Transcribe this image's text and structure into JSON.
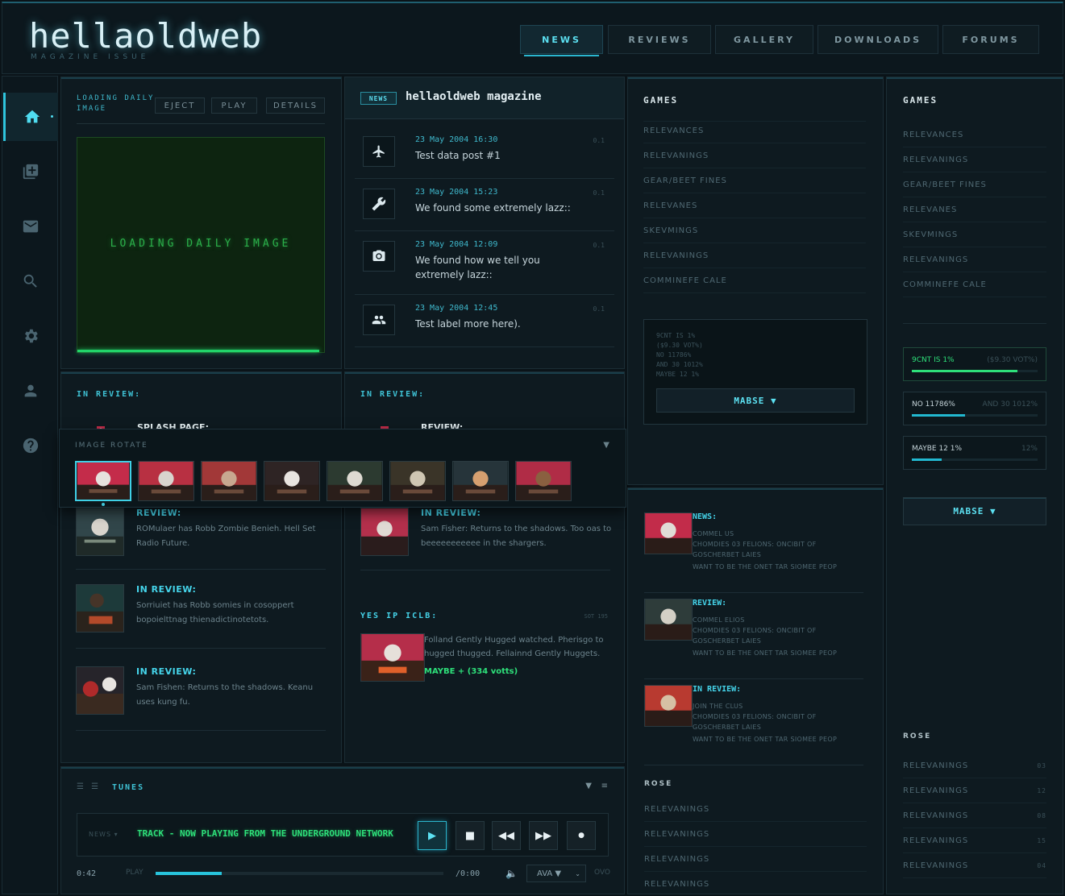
{
  "header": {
    "logo": "hellaoldweb",
    "subtitle": "MAGAZINE ISSUE",
    "nav": [
      {
        "label": "NEWS",
        "active": true
      },
      {
        "label": "REVIEWS"
      },
      {
        "label": "GALLERY"
      },
      {
        "label": "DOWNLOADS"
      },
      {
        "label": "FORUMS"
      }
    ]
  },
  "sidebar": {
    "icons": [
      "home-icon",
      "add-collection-icon",
      "mail-icon",
      "search-icon",
      "gear-icon",
      "user-icon",
      "help-icon"
    ]
  },
  "daily_image": {
    "label": "LOADING DAILY IMAGE",
    "eject": "EJECT",
    "play": "PLAY",
    "details": "DETAILS",
    "screen_text": "LOADING DAILY IMAGE",
    "progress": 0.98
  },
  "news": {
    "badge": "NEWS",
    "title": "hellaoldweb magazine",
    "posts": [
      {
        "icon": "airplane-icon",
        "date": "23 May 2004 16:30",
        "text": "Test data post #1",
        "num": "0.1"
      },
      {
        "icon": "wrench-icon",
        "date": "23 May 2004 15:23",
        "text": "We found some extremely lazz::",
        "num": "0.1"
      },
      {
        "icon": "camera-icon",
        "date": "23 May 2004 12:09",
        "text": "We found how we tell you extremely lazz::",
        "num": "0.1"
      },
      {
        "icon": "users-icon",
        "date": "23 May 2004 12:45",
        "text": "Test label more here).",
        "num": "0.1"
      }
    ]
  },
  "review_left": {
    "title": "IN REVIEW:",
    "peek_title": "SPLASH PAGE:",
    "items": [
      {
        "title": "REVIEW:",
        "text": "ROMulaer has Robb Zombie Benieh. Hell Set Radio Future."
      },
      {
        "title": "IN REVIEW:",
        "text": "Sorriuiet has Robb somies in cosoppert bopoielttnag thienadictinotetots."
      },
      {
        "title": "IN REVIEW:",
        "text": "Sam Fishen: Returns to the shadows. Keanu uses kung fu."
      }
    ]
  },
  "review_mid": {
    "title": "IN REVIEW:",
    "peek_title": "REVIEW:",
    "item": {
      "title": "IN REVIEW:",
      "text": "Sam Fisher: Returns to the shadows. Too oas to beeeeeeeeeee in the shargers."
    },
    "yes_title": "YES IP ICLB:",
    "yes_meta": "SOT 195",
    "yes_text": "Folland Gently Hugged watched. Pherisgo to hugged thugged. Fellainnd Gently Huggets.",
    "yes_vote": "MAYBE + (334 votts)"
  },
  "rotate": {
    "title": "IMAGE ROTATE",
    "caret": "▼",
    "count": 8
  },
  "games_col3": {
    "title": "GAMES",
    "links": [
      "RELEVANCES",
      "RELEVANINGS",
      "GEAR/BEET FINES",
      "RELEVANES",
      "SKEVMINGS",
      "RELEVANINGS",
      "COMMINEFE CALE"
    ],
    "poll_lines": [
      "9CNT IS 1%",
      "($9.30 VOT%)",
      "NO 11786%",
      "AND 30 1012%",
      "MAYBE 12 1%"
    ],
    "poll_button": "MABSE ▼"
  },
  "featured": {
    "items": [
      {
        "title": "NEWS:",
        "l1": "COMMEL US",
        "l2": "CHOMDIES 03 FELIONS: ONCIBIT OF GOSCHERBET LAIES",
        "l3": "WANT TO BE THE ONET TAR SIOMEE PEOP"
      },
      {
        "title": "REVIEW:",
        "l1": "COMMEL ELIOS",
        "l2": "CHOMDIES 03 FELIONS: ONCIBIT OF GOSCHERBET LAIES",
        "l3": "WANT TO BE THE ONET TAR SIOMEE PEOP"
      },
      {
        "title": "IN REVIEW:",
        "l1": "JOIN THE CLUS",
        "l2": "CHOMDIES 03 FELIONS: ONCIBIT OF GOSCHERBET LAIES",
        "l3": "WANT TO BE THE ONET TAR SIOMEE PEOP"
      }
    ],
    "rose_title": "ROSE",
    "rose_links": [
      "RELEVANINGS",
      "RELEVANINGS",
      "RELEVANINGS",
      "RELEVANINGS"
    ]
  },
  "games_col4": {
    "title": "GAMES",
    "links": [
      "RELEVANCES",
      "RELEVANINGS",
      "GEAR/BEET FINES",
      "RELEVANES",
      "SKEVMINGS",
      "RELEVANINGS",
      "COMMINEFE CALE"
    ],
    "stats": [
      {
        "label": "9CNT IS 1%",
        "right": "($9.30 VOT%)",
        "fill": 0.84
      },
      {
        "label": "NO 11786%",
        "right": "AND 30 1012%",
        "fill": 0.42
      },
      {
        "label": "MAYBE 12 1%",
        "right": "12%",
        "fill": 0.24
      }
    ],
    "button": "MABSE ▼",
    "rose_title": "ROSE",
    "rose_links": [
      {
        "label": "RELEVANINGS",
        "num": "03"
      },
      {
        "label": "RELEVANINGS",
        "num": "12"
      },
      {
        "label": "RELEVANINGS",
        "num": "08"
      },
      {
        "label": "RELEVANINGS",
        "num": "15"
      },
      {
        "label": "RELEVANINGS",
        "num": "04"
      }
    ]
  },
  "tunes": {
    "title": "TUNES",
    "source": "NEWS",
    "track": "TRACK - NOW PLAYING FROM THE UNDERGROUND NETWORK",
    "time": "0:42",
    "play_label": "PLAY",
    "total": "/0:00",
    "progress": 0.23,
    "select": "AVA ▼",
    "ovo": "OVO"
  },
  "colors": {
    "accent": "#3fc3d6",
    "green": "#2ee07a",
    "bg": "#0a1318"
  }
}
